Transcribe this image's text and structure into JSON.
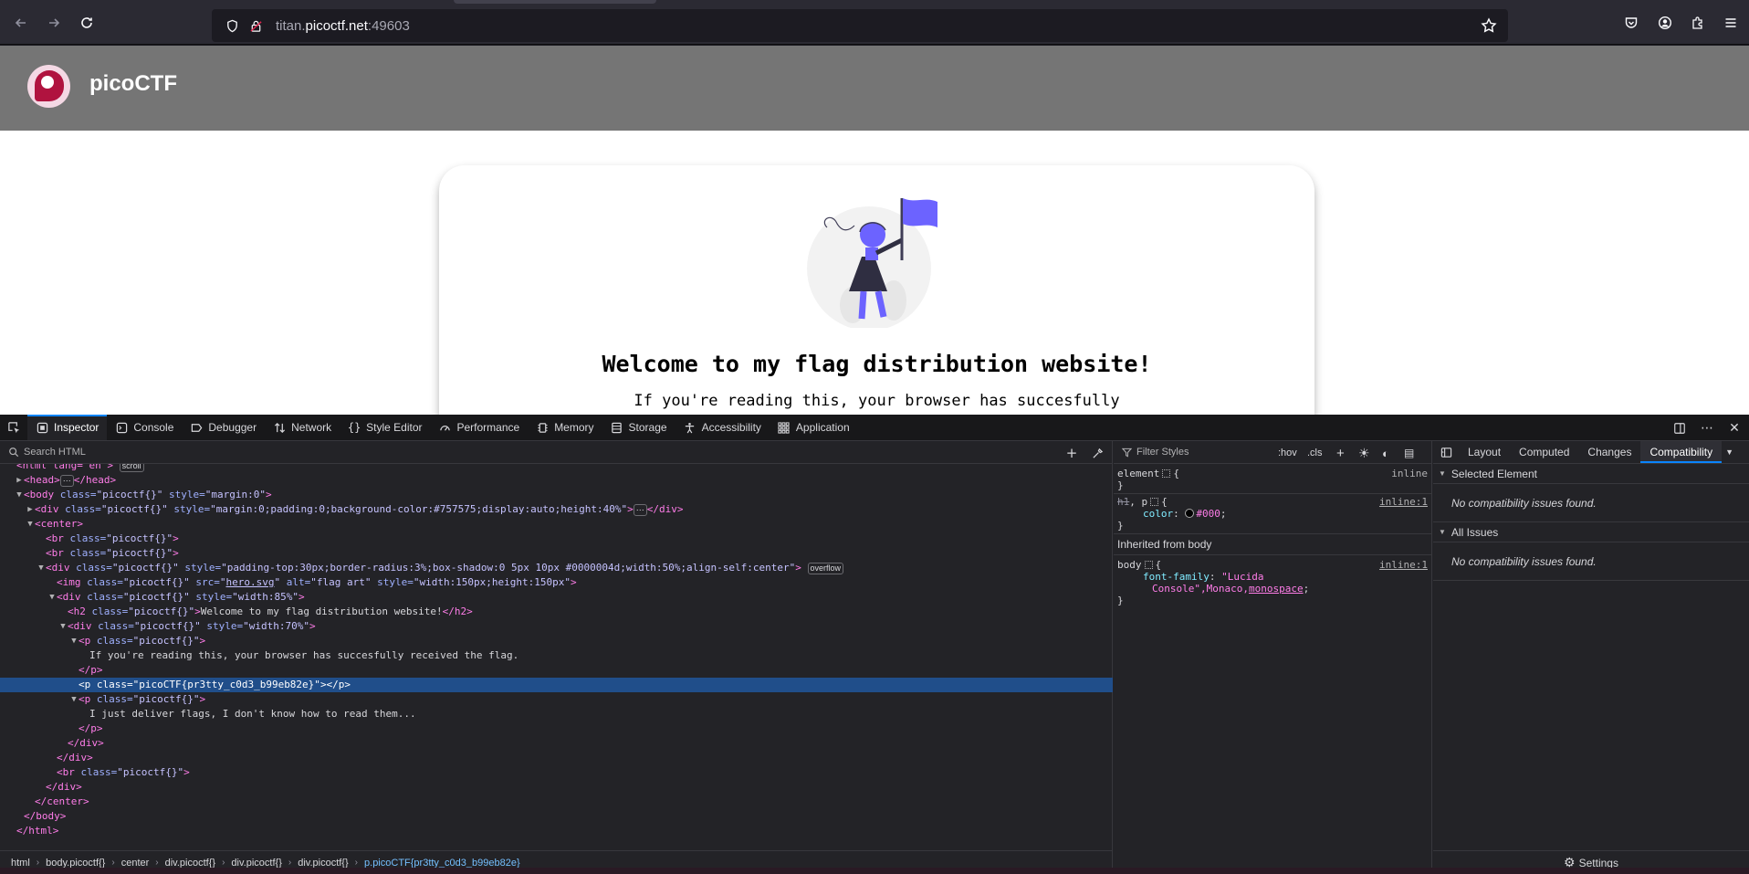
{
  "browser": {
    "url_host": "titan.",
    "url_domain": "picoctf.net",
    "url_port": ":49603"
  },
  "page": {
    "site_name": "picoCTF",
    "heading": "Welcome to my flag distribution website!",
    "subtext": "If you're reading this, your browser has succesfully"
  },
  "devtools": {
    "tabs": [
      {
        "label": "Inspector",
        "icon": "inspector-icon"
      },
      {
        "label": "Console",
        "icon": "console-icon"
      },
      {
        "label": "Debugger",
        "icon": "debugger-icon"
      },
      {
        "label": "Network",
        "icon": "network-icon"
      },
      {
        "label": "Style Editor",
        "icon": "style-editor-icon"
      },
      {
        "label": "Performance",
        "icon": "performance-icon"
      },
      {
        "label": "Memory",
        "icon": "memory-icon"
      },
      {
        "label": "Storage",
        "icon": "storage-icon"
      },
      {
        "label": "Accessibility",
        "icon": "accessibility-icon"
      },
      {
        "label": "Application",
        "icon": "application-icon"
      }
    ],
    "search_placeholder": "Search HTML",
    "markup": {
      "l0": "<html lang=\"en\">",
      "l0_badge": "scroll",
      "l1_open": "<head>",
      "l1_close": "</head>",
      "body_tag": "<body",
      "body_class_attr": "class=",
      "body_class_val": "\"picoctf{}\"",
      "body_style_attr": "style=",
      "body_style_val": "\"margin:0\"",
      "div1_style_val": "\"margin:0;padding:0;background-color:#757575;display:auto;height:40%\"",
      "card_style_val": "\"padding-top:30px;border-radius:3%;box-shadow:0 5px 10px #0000004d;width:50%;align-self:center\"",
      "card_badge": "overflow",
      "img_src_val": "hero.svg",
      "img_alt_val": "\"flag art\"",
      "img_style_val": "\"width:150px;height:150px\"",
      "div85_style_val": "\"width:85%\"",
      "h2_text": "Welcome to my flag distribution website!",
      "div70_style_val": "\"width:70%\"",
      "p1_text": "If you're reading this, your browser has succesfully received the flag.",
      "flag_class_val": "\"picoCTF{pr3tty_c0d3_b99eb82e}\"",
      "p2_text": "I just deliver flags, I don't know how to read them...",
      "class_val": "\"picoctf{}\""
    },
    "breadcrumbs": [
      "html",
      "body.picoctf{}",
      "center",
      "div.picoctf{}",
      "div.picoctf{}",
      "div.picoctf{}",
      "p.picoCTF{pr3tty_c0d3_b99eb82e}"
    ],
    "rules": {
      "filter_placeholder": "Filter Styles",
      "hov": ":hov",
      "cls": ".cls",
      "element_selector": "element",
      "element_source": "inline",
      "rule2_selector_strike": "h1",
      "rule2_selector": ", p",
      "rule2_source": "inline:1",
      "rule2_prop": "color",
      "rule2_val": "#000",
      "inherited_label": "Inherited from body",
      "rule3_selector": "body",
      "rule3_source": "inline:1",
      "rule3_prop": "font-family",
      "rule3_val_a": "\"Lucida",
      "rule3_val_b": "Console\",Monaco,",
      "rule3_val_c": "monospace"
    },
    "side_tabs": [
      "Layout",
      "Computed",
      "Changes",
      "Compatibility"
    ],
    "compat": {
      "selected_element": "Selected Element",
      "selected_msg": "No compatibility issues found.",
      "all_issues": "All Issues",
      "all_msg": "No compatibility issues found.",
      "settings": "Settings"
    }
  }
}
